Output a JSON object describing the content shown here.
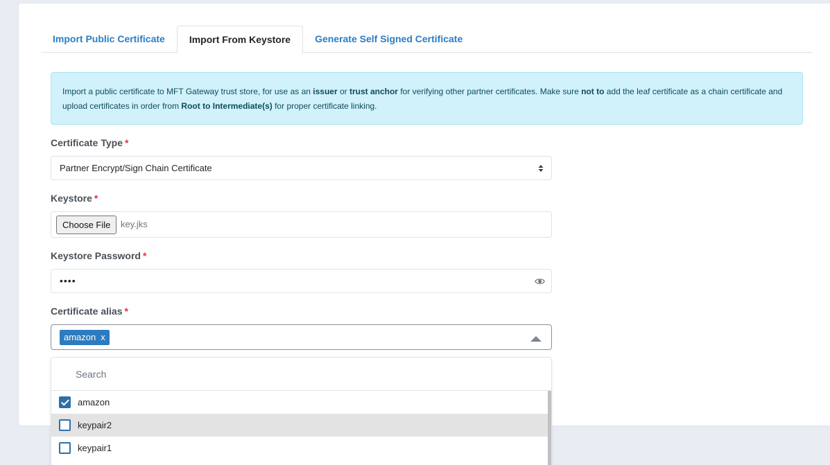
{
  "tabs": [
    {
      "label": "Import Public Certificate",
      "active": false
    },
    {
      "label": "Import From Keystore",
      "active": true
    },
    {
      "label": "Generate Self Signed Certificate",
      "active": false
    }
  ],
  "alert": {
    "p1": "Import a public certificate to MFT Gateway trust store, for use as an ",
    "b1": "issuer",
    "p2": " or ",
    "b2": "trust anchor",
    "p3": " for verifying other partner certificates. Make sure ",
    "b3": "not to",
    "p4": " add the leaf certificate as a chain certificate and upload certificates in order from ",
    "b4": "Root to Intermediate(s)",
    "p5": " for proper certificate linking."
  },
  "form": {
    "certificate_type": {
      "label": "Certificate Type",
      "required_mark": "*",
      "value": "Partner Encrypt/Sign Chain Certificate"
    },
    "keystore": {
      "label": "Keystore",
      "required_mark": "*",
      "button_label": "Choose File",
      "file_name": "key.jks"
    },
    "keystore_password": {
      "label": "Keystore Password",
      "required_mark": "*",
      "masked_value": "••••"
    },
    "certificate_alias": {
      "label": "Certificate alias",
      "required_mark": "*",
      "selected_tag": "amazon",
      "tag_remove": "x"
    }
  },
  "dropdown": {
    "search_placeholder": "Search",
    "options": [
      {
        "label": "amazon",
        "checked": true,
        "highlighted": false
      },
      {
        "label": "keypair2",
        "checked": false,
        "highlighted": true
      },
      {
        "label": "keypair1",
        "checked": false,
        "highlighted": false
      },
      {
        "label": "",
        "checked": false,
        "highlighted": false
      }
    ]
  },
  "colors": {
    "link": "#2a7dc6",
    "alert_bg": "#d1f2fb",
    "tag_bg": "#2e7bbf",
    "required": "#dc3545"
  }
}
